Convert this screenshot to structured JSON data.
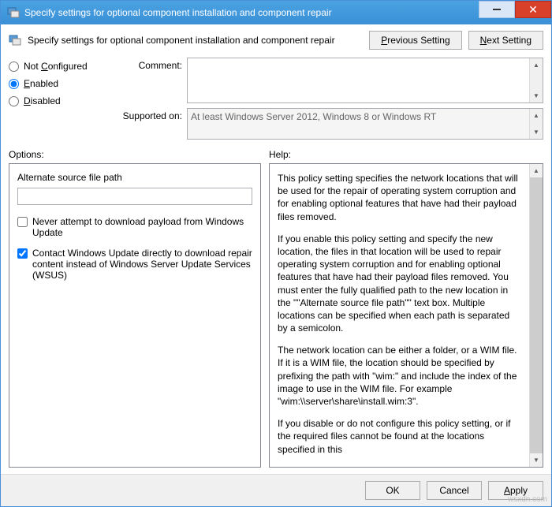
{
  "titlebar": {
    "title": "Specify settings for optional component installation and component repair"
  },
  "header": {
    "description": "Specify settings for optional component installation and component repair",
    "prev_button": "Previous Setting",
    "next_button": "Next Setting",
    "prev_u": "P",
    "next_u": "N"
  },
  "radios": {
    "not_configured": "Not Configured",
    "nc_u": "C",
    "enabled": "Enabled",
    "en_u": "E",
    "disabled": "Disabled",
    "di_u": "D",
    "selected": "enabled"
  },
  "fields": {
    "comment_label": "Comment:",
    "comment_value": "",
    "supported_label": "Supported on:",
    "supported_value": "At least Windows Server 2012, Windows 8 or Windows RT"
  },
  "sections": {
    "options_label": "Options:",
    "help_label": "Help:"
  },
  "options": {
    "alt_path_label": "Alternate source file path",
    "alt_path_value": "",
    "never_download": "Never attempt to download payload from Windows Update",
    "never_download_checked": false,
    "contact_wu": "Contact Windows Update directly to download repair content instead of Windows Server Update Services (WSUS)",
    "contact_wu_checked": true
  },
  "help": {
    "p1": "This policy setting specifies the network locations that will be used for the repair of operating system corruption and for enabling optional features that have had their payload files removed.",
    "p2": "If you enable this policy setting and specify the new location, the files in that location will be used to repair operating system corruption and for enabling optional features that have had their payload files removed. You must enter the fully qualified path to the new location in the \"\"Alternate source file path\"\" text box. Multiple locations can be specified when each path is separated by a semicolon.",
    "p3": "The network location can be either a folder, or a WIM file. If it is a WIM file, the location should be specified by prefixing the path with \"wim:\" and include the index of the image to use in the WIM file. For example \"wim:\\\\server\\share\\install.wim:3\".",
    "p4": "If you disable or do not configure this policy setting, or if the required files cannot be found at the locations specified in this"
  },
  "buttons": {
    "ok": "OK",
    "cancel": "Cancel",
    "apply": "Apply",
    "apply_u": "A"
  },
  "watermark": "wsxdn.com"
}
